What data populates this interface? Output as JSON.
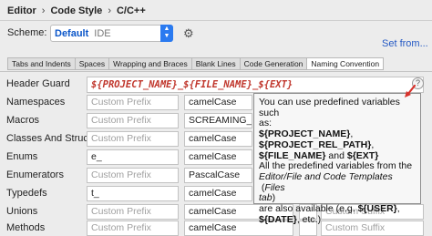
{
  "breadcrumb": {
    "items": [
      "Editor",
      "Code Style",
      "C/C++"
    ],
    "separator": "›"
  },
  "scheme": {
    "label": "Scheme:",
    "value": "Default",
    "type": "IDE"
  },
  "set_from_link": "Set from...",
  "tabs": [
    {
      "label": "Tabs and Indents",
      "active": false
    },
    {
      "label": "Spaces",
      "active": false
    },
    {
      "label": "Wrapping and Braces",
      "active": false
    },
    {
      "label": "Blank Lines",
      "active": false
    },
    {
      "label": "Code Generation",
      "active": false
    },
    {
      "label": "Naming Convention",
      "active": true
    }
  ],
  "header_guard": {
    "label": "Header Guard",
    "value": "${PROJECT_NAME}_${FILE_NAME}_${EXT}"
  },
  "rows": [
    {
      "label": "Namespaces",
      "prefix": "",
      "prefix_placeholder": "Custom Prefix",
      "style": "camelCase"
    },
    {
      "label": "Macros",
      "prefix": "",
      "prefix_placeholder": "Custom Prefix",
      "style": "SCREAMING_SNA"
    },
    {
      "label": "Classes And Structs",
      "prefix": "",
      "prefix_placeholder": "Custom Prefix",
      "style": "camelCase"
    },
    {
      "label": "Enums",
      "prefix": "e_",
      "prefix_placeholder": "Custom Prefix",
      "style": "camelCase"
    },
    {
      "label": "Enumerators",
      "prefix": "",
      "prefix_placeholder": "Custom Prefix",
      "style": "PascalCase"
    },
    {
      "label": "Typedefs",
      "prefix": "t_",
      "prefix_placeholder": "Custom Prefix",
      "style": "camelCase"
    },
    {
      "label": "Unions",
      "prefix": "",
      "prefix_placeholder": "Custom Prefix",
      "style": "camelCase"
    },
    {
      "label": "Methods",
      "prefix": "",
      "prefix_placeholder": "Custom Prefix",
      "style": "camelCase"
    }
  ],
  "suffix_placeholder": "Custom Suffix",
  "tooltip": {
    "line1": "You can use predefined variables such",
    "line2": "as:",
    "var1": "${PROJECT_NAME}",
    "var2": "${PROJECT_REL_PATH}",
    "var3": "${FILE_NAME}",
    "and": " and ",
    "var4": "${EXT}",
    "line3": "All the predefined variables from the",
    "italic1": "Editor/File and Code Templates",
    "paren_open": " (",
    "italic2": "Files",
    "line4a": "tab",
    "line4b": ")",
    "line5a": "are also available (e.g. ",
    "var5": "${USER}",
    "comma": ",",
    "var6": "${DATE}",
    "line6b": ", etc.)"
  },
  "colors": {
    "accent": "#2a7af0",
    "link": "#2459c4",
    "header_guard_text": "#c0362c",
    "arrow": "#d9322b"
  },
  "icons": {
    "gear": "gear-icon",
    "help": "help-icon",
    "dropdown": "chevron-updown-icon"
  }
}
